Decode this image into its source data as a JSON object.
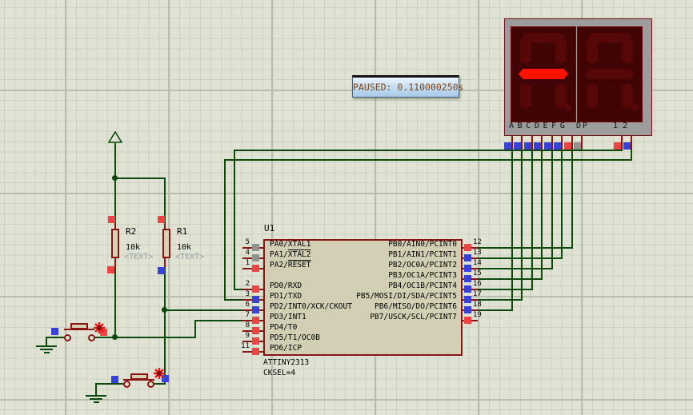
{
  "simulation": {
    "status_text": "PAUSED: 0.110000250s"
  },
  "colors": {
    "logic_high": "#f04343",
    "logic_low": "#3942d6",
    "logic_float": "#8f948f",
    "wire_green": "#0c4a0c",
    "component_maroon": "#8a1414",
    "segment_lit": "#ff1100"
  },
  "mcu": {
    "ref": "U1",
    "part": "ATTINY2313",
    "note": "CKSEL=4",
    "left_pins": [
      {
        "num": "5",
        "name_pre": "PA0/XTAL1",
        "name_ov": "",
        "state": "float"
      },
      {
        "num": "4",
        "name_pre": "PA1/",
        "name_ov": "XTAL2",
        "state": "float"
      },
      {
        "num": "1",
        "name_pre": "PA2/",
        "name_ov": "RESET",
        "state": "high"
      },
      {
        "num": "2",
        "name_pre": "PD0/RXD",
        "name_ov": "",
        "state": "high"
      },
      {
        "num": "3",
        "name_pre": "PD1/TXD",
        "name_ov": "",
        "state": "low"
      },
      {
        "num": "6",
        "name_pre": "PD2/INT0/XCK/CKOUT",
        "name_ov": "",
        "state": "low"
      },
      {
        "num": "7",
        "name_pre": "PD3/INT1",
        "name_ov": "",
        "state": "high"
      },
      {
        "num": "8",
        "name_pre": "PD4/T0",
        "name_ov": "",
        "state": "high"
      },
      {
        "num": "9",
        "name_pre": "PD5/T1/OC0B",
        "name_ov": "",
        "state": "high"
      },
      {
        "num": "11",
        "name_pre": "PD6/ICP",
        "name_ov": "",
        "state": "high"
      }
    ],
    "right_pins": [
      {
        "num": "12",
        "name": "PB0/AIN0/PCINT0",
        "state": "high"
      },
      {
        "num": "13",
        "name": "PB1/AIN1/PCINT1",
        "state": "low"
      },
      {
        "num": "14",
        "name": "PB2/OC0A/PCINT2",
        "state": "low"
      },
      {
        "num": "15",
        "name": "PB3/OC1A/PCINT3",
        "state": "low"
      },
      {
        "num": "16",
        "name": "PB4/OC1B/PCINT4",
        "state": "low"
      },
      {
        "num": "17",
        "name": "PB5/MOSI/DI/SDA/PCINT5",
        "state": "low"
      },
      {
        "num": "18",
        "name": "PB6/MISO/DO/PCINT6",
        "state": "low"
      },
      {
        "num": "19",
        "name": "PB7/USCK/SCL/PCINT7",
        "state": "high"
      }
    ]
  },
  "resistors": [
    {
      "ref": "R2",
      "value": "10k",
      "placeholder": "<TEXT>",
      "top_state": "high",
      "bottom_state": "high"
    },
    {
      "ref": "R1",
      "value": "10k",
      "placeholder": "<TEXT>",
      "top_state": "high",
      "bottom_state": "low"
    }
  ],
  "buttons": [
    {
      "probe_left": "low",
      "probe_right": "high"
    },
    {
      "probe_left": "low",
      "probe_right": "low"
    }
  ],
  "display": {
    "segment_labels": "ABCDEFG",
    "dp_label": "DP",
    "digit_index_labels": "12",
    "digits": [
      {
        "segments": {
          "a": "off",
          "b": "off",
          "c": "off",
          "d": "off",
          "e": "off",
          "f": "off",
          "g": "on",
          "dp": "off"
        }
      },
      {
        "segments": {
          "a": "off",
          "b": "off",
          "c": "off",
          "d": "off",
          "e": "off",
          "f": "off",
          "g": "off",
          "dp": "off"
        }
      }
    ],
    "pin_states": {
      "a": "low",
      "b": "low",
      "c": "low",
      "d": "low",
      "e": "low",
      "f": "low",
      "g": "high",
      "dp": "float",
      "digit1": "high",
      "digit2": "low"
    }
  }
}
